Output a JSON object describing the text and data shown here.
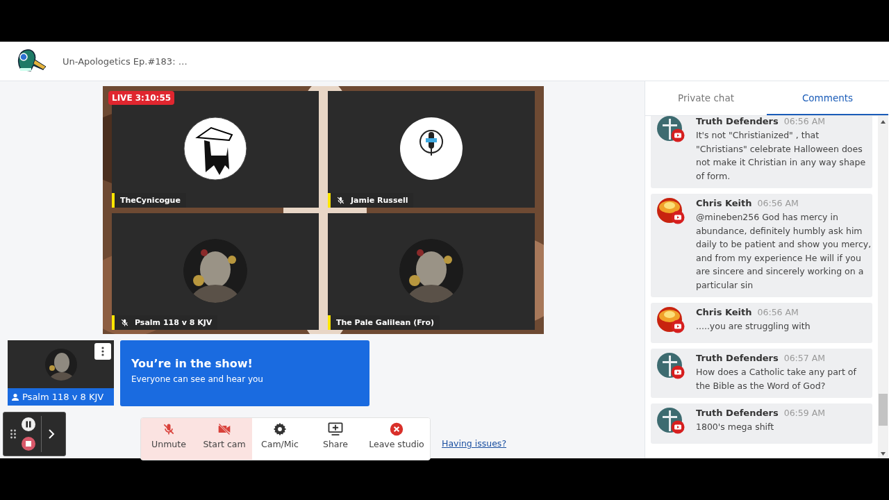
{
  "header": {
    "title": "Un-Apologetics Ep.#183: …"
  },
  "stage": {
    "live_badge": "LIVE 3:10:55",
    "tiles": [
      {
        "name": "TheCynicogue",
        "muted": false,
        "kind": "cartoon"
      },
      {
        "name": "Jamie Russell",
        "muted": true,
        "kind": "logo"
      },
      {
        "name": "Psalm 118 v 8 KJV",
        "muted": true,
        "kind": "picture"
      },
      {
        "name": "The Pale Galilean (Fro)",
        "muted": false,
        "kind": "picture"
      }
    ]
  },
  "self_tile": {
    "name": "Psalm 118 v 8 KJV"
  },
  "banner": {
    "title": "You’re in the show!",
    "text": "Everyone can see and hear you"
  },
  "toolbar": {
    "buttons": [
      {
        "label": "Unmute",
        "kind": "mic-off",
        "highlighted": true
      },
      {
        "label": "Start cam",
        "kind": "cam-off",
        "highlighted": true
      },
      {
        "label": "Cam/Mic",
        "kind": "settings",
        "highlighted": false
      },
      {
        "label": "Share",
        "kind": "share",
        "highlighted": false
      },
      {
        "label": "Leave studio",
        "kind": "leave",
        "highlighted": false
      }
    ],
    "link": "Having issues?"
  },
  "chat": {
    "tabs": [
      {
        "label": "Private chat",
        "selected": false
      },
      {
        "label": "Comments",
        "selected": true
      }
    ],
    "comments": [
      {
        "author": "Truth Defenders",
        "time": "06:56 AM",
        "kind": "cross",
        "text": "It's not \"Christianized\" , that \"Christians\" celebrate Halloween does not make it Christian in any way shape of form."
      },
      {
        "author": "Chris Keith",
        "time": "06:56 AM",
        "kind": "sun",
        "text": "@mineben256 God has mercy in abundance, definitely humbly ask him daily to be patient and show you mercy, and from my experience He will if you are sincere and sincerely working on a particular sin"
      },
      {
        "author": "Chris Keith",
        "time": "06:56 AM",
        "kind": "sun",
        "text": ".....you are struggling with"
      },
      {
        "author": "Truth Defenders",
        "time": "06:57 AM",
        "kind": "cross",
        "text": "How does a Catholic take any part of the Bible as the Word of God?"
      },
      {
        "author": "Truth Defenders",
        "time": "06:59 AM",
        "kind": "cross",
        "text": "1800's mega shift"
      }
    ]
  }
}
